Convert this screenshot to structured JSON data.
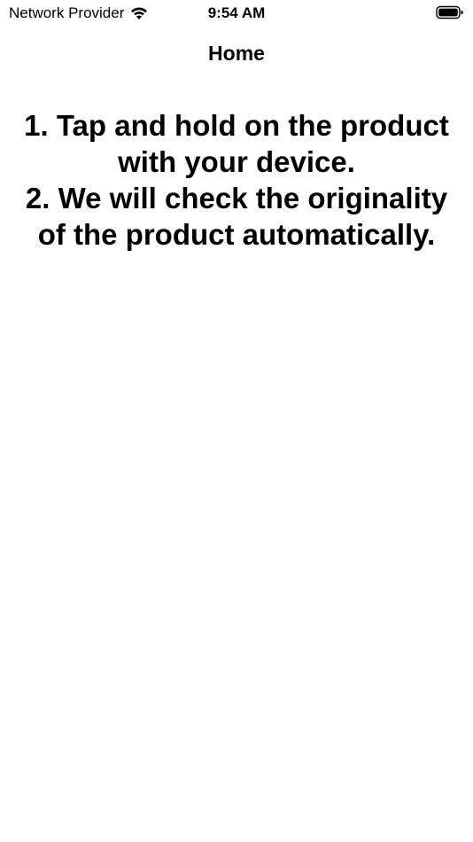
{
  "status_bar": {
    "carrier": "Network Provider",
    "time": "9:54 AM",
    "wifi_icon": "wifi-icon",
    "battery_icon": "battery-icon"
  },
  "nav": {
    "title": "Home"
  },
  "instructions": {
    "lines": [
      "1. Tap and hold on the product",
      "with your device.",
      "2. We will check the originality",
      "of the product automatically."
    ]
  }
}
